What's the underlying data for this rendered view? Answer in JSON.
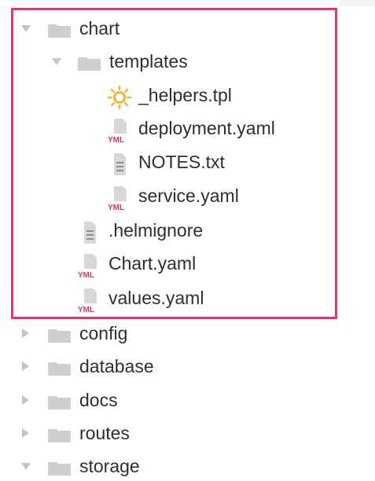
{
  "tree": {
    "items": [
      {
        "label": "chart",
        "kind": "folder",
        "expanded": true,
        "depth": 0
      },
      {
        "label": "templates",
        "kind": "folder",
        "expanded": true,
        "depth": 1
      },
      {
        "label": "_helpers.tpl",
        "kind": "file",
        "icon": "helper-tpl-icon",
        "depth": 2
      },
      {
        "label": "deployment.yaml",
        "kind": "file",
        "icon": "yaml-file-icon",
        "depth": 2
      },
      {
        "label": "NOTES.txt",
        "kind": "file",
        "icon": "text-file-icon",
        "depth": 2
      },
      {
        "label": "service.yaml",
        "kind": "file",
        "icon": "yaml-file-icon",
        "depth": 2
      },
      {
        "label": ".helmignore",
        "kind": "file",
        "icon": "text-file-icon",
        "depth": 1
      },
      {
        "label": "Chart.yaml",
        "kind": "file",
        "icon": "yaml-file-icon",
        "depth": 1
      },
      {
        "label": "values.yaml",
        "kind": "file",
        "icon": "yaml-file-icon",
        "depth": 1
      },
      {
        "label": "config",
        "kind": "folder",
        "expanded": false,
        "depth": 0
      },
      {
        "label": "database",
        "kind": "folder",
        "expanded": false,
        "depth": 0
      },
      {
        "label": "docs",
        "kind": "folder",
        "expanded": false,
        "depth": 0
      },
      {
        "label": "routes",
        "kind": "folder",
        "expanded": false,
        "depth": 0
      },
      {
        "label": "storage",
        "kind": "folder",
        "expanded": true,
        "depth": 0
      }
    ],
    "yml_badge_text": "YML"
  },
  "colors": {
    "highlight_border": "#e8336f",
    "folder": "#cfcfcf",
    "arrow": "#c4c4c4",
    "yml_badge": "#d6335a",
    "helper_icon": "#f2b33a"
  }
}
